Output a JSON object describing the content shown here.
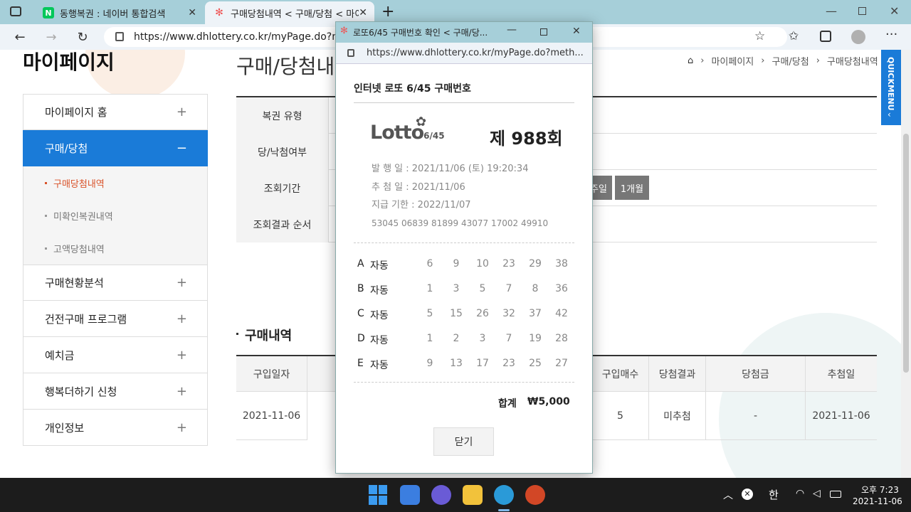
{
  "browser": {
    "tabs": [
      {
        "label": "동행복권 : 네이버 통합검색",
        "icon": "naver-icon"
      },
      {
        "label": "구매당첨내역 < 구매/당첨 < 마이",
        "icon": "lotto-icon"
      }
    ],
    "url": "https://www.dhlottery.co.kr/myPage.do?meth"
  },
  "breadcrumb": [
    "마이페이지",
    "구매/당첨",
    "구매당첨내역"
  ],
  "page": {
    "mypage_title": "마이페이지",
    "section_title": "구매/당첨내",
    "quickmenu": "QUICKMENU"
  },
  "sidebar": {
    "items": [
      {
        "label": "마이페이지 홈"
      },
      {
        "label": "구매/당첨"
      },
      {
        "label": "구매현황분석"
      },
      {
        "label": "건전구매 프로그램"
      },
      {
        "label": "예치금"
      },
      {
        "label": "행복더하기 신청"
      },
      {
        "label": "개인정보"
      }
    ],
    "sub_items": [
      {
        "label": "구매당첨내역"
      },
      {
        "label": "미확인복권내역"
      },
      {
        "label": "고액당첨내역"
      }
    ],
    "plus": "+",
    "minus": "−"
  },
  "filter": {
    "rows": [
      "복권 유형",
      "당/낙첨여부",
      "조회기간",
      "조회결과 순서"
    ],
    "btn_week": "주일",
    "btn_month": "1개월"
  },
  "purchase": {
    "title": "구매내역",
    "headers": [
      "구입일자",
      "구입매수",
      "당첨결과",
      "당첨금",
      "추첨일"
    ],
    "row": {
      "date": "2021-11-06",
      "count": "5",
      "result": "미추첨",
      "prize": "-",
      "draw_date": "2021-11-06"
    }
  },
  "popup": {
    "window_title": "로또6/45 구매번호 확인 < 구매/당...",
    "url": "https://www.dhlottery.co.kr/myPage.do?meth...",
    "heading": "인터넷 로또 6/45 구매번호",
    "logo_text": "Lotto",
    "logo_sub": "6/45",
    "round": "제 988회",
    "issue_date": "발 행 일 : 2021/11/06 (토) 19:20:34",
    "draw_date": "추 첨 일 : 2021/11/06",
    "pay_deadline": "지급 기한 : 2022/11/07",
    "serial": "53045 06839 81899 43077 17002 49910",
    "games": [
      {
        "label": "A",
        "type": "자동",
        "numbers": [
          6,
          9,
          10,
          23,
          29,
          38
        ]
      },
      {
        "label": "B",
        "type": "자동",
        "numbers": [
          1,
          3,
          5,
          7,
          8,
          36
        ]
      },
      {
        "label": "C",
        "type": "자동",
        "numbers": [
          5,
          15,
          26,
          32,
          37,
          42
        ]
      },
      {
        "label": "D",
        "type": "자동",
        "numbers": [
          1,
          2,
          3,
          7,
          19,
          28
        ]
      },
      {
        "label": "E",
        "type": "자동",
        "numbers": [
          9,
          13,
          17,
          23,
          25,
          27
        ]
      }
    ],
    "total_label": "합계",
    "total_value": "₩5,000",
    "close_label": "닫기"
  },
  "taskbar": {
    "ime": "한",
    "time": "오후 7:23",
    "date": "2021-11-06"
  }
}
